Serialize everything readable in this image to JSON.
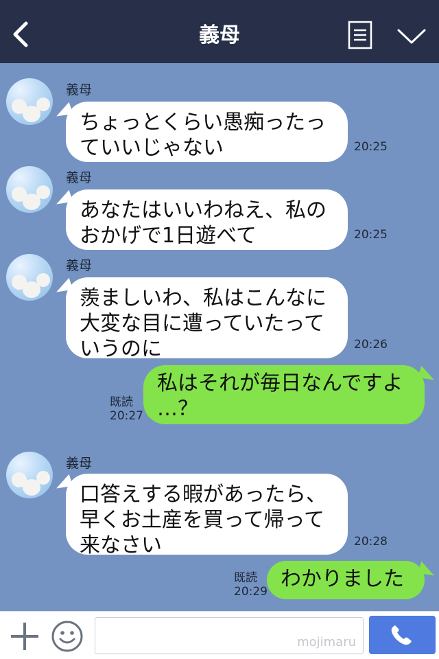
{
  "header": {
    "title": "義母"
  },
  "messages": [
    {
      "sender": "義母",
      "lines": [
        "ちょっとくらい愚痴ったっ",
        "ていいじゃない"
      ],
      "time": "20:25"
    },
    {
      "sender": "義母",
      "lines": [
        "あなたはいいわねえ、私の",
        "おかげで1日遊べて"
      ],
      "time": "20:25"
    },
    {
      "sender": "義母",
      "lines": [
        "羨ましいわ、私はこんなに",
        "大変な目に遭っていたって",
        "いうのに"
      ],
      "time": "20:26"
    },
    {
      "lines": [
        "私はそれが毎日なんですよ",
        "…？"
      ],
      "read": "既読",
      "time": "20:27"
    },
    {
      "sender": "義母",
      "lines": [
        "口答えする暇があったら、",
        "早くお土産を買って帰って",
        "来なさい"
      ],
      "time": "20:28"
    },
    {
      "lines": [
        "わかりました"
      ],
      "read": "既読",
      "time": "20:29"
    }
  ],
  "footer": {
    "watermark": "mojimaru"
  },
  "colors": {
    "header": "#273048",
    "chat_bg": "#7593c2",
    "outgoing_bubble": "#84e34a",
    "send_button": "#4f7be0"
  }
}
